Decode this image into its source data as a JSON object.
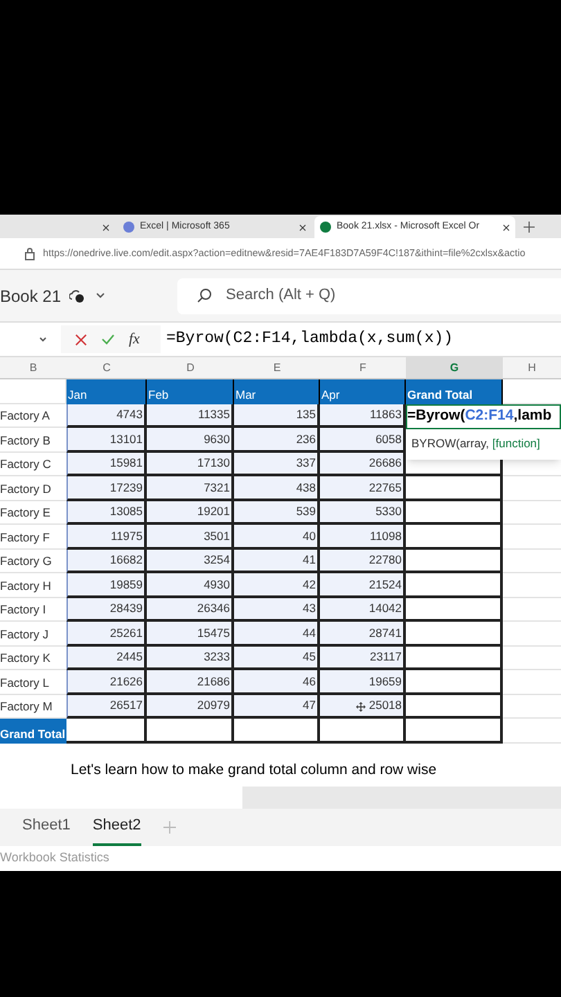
{
  "browser": {
    "tabs": [
      {
        "selected": false
      },
      {
        "title": "Excel | Microsoft 365",
        "selected": false
      },
      {
        "title": "Book 21.xlsx - Microsoft Excel Or",
        "selected": true
      }
    ],
    "url": "https://onedrive.live.com/edit.aspx?action=editnew&resid=7AE4F183D7A59F4C!187&ithint=file%2cxlsx&actio"
  },
  "app": {
    "doc_title": "Book 21",
    "search": {
      "placeholder": "Search (Alt + Q)"
    }
  },
  "formula_bar": {
    "function_label": "fx",
    "formula": "=Byrow(C2:F14,lambda(x,sum(x))"
  },
  "column_headers": [
    {
      "label": "B",
      "selected": false
    },
    {
      "label": "C",
      "selected": false
    },
    {
      "label": "D",
      "selected": false
    },
    {
      "label": "E",
      "selected": false
    },
    {
      "label": "F",
      "selected": false
    },
    {
      "label": "G",
      "selected": true
    },
    {
      "label": "H",
      "selected": false
    }
  ],
  "table": {
    "header": [
      "Jan",
      "Feb",
      "Mar",
      "Apr",
      "Grand Total"
    ],
    "rows": [
      {
        "label": "Factory A",
        "values": [
          "4743",
          "11335",
          "135",
          "11863"
        ]
      },
      {
        "label": "Factory B",
        "values": [
          "13101",
          "9630",
          "236",
          "6058"
        ]
      },
      {
        "label": "Factory C",
        "values": [
          "15981",
          "17130",
          "337",
          "26686"
        ]
      },
      {
        "label": "Factory D",
        "values": [
          "17239",
          "7321",
          "438",
          "22765"
        ]
      },
      {
        "label": "Factory E",
        "values": [
          "13085",
          "19201",
          "539",
          "5330"
        ]
      },
      {
        "label": "Factory F",
        "values": [
          "11975",
          "3501",
          "40",
          "11098"
        ]
      },
      {
        "label": "Factory G",
        "values": [
          "16682",
          "3254",
          "41",
          "22780"
        ]
      },
      {
        "label": "Factory H",
        "values": [
          "19859",
          "4930",
          "42",
          "21524"
        ]
      },
      {
        "label": "Factory I",
        "values": [
          "28439",
          "26346",
          "43",
          "14042"
        ]
      },
      {
        "label": "Factory J",
        "values": [
          "25261",
          "15475",
          "44",
          "28741"
        ]
      },
      {
        "label": "Factory K",
        "values": [
          "2445",
          "3233",
          "45",
          "23117"
        ]
      },
      {
        "label": "Factory L",
        "values": [
          "21626",
          "21686",
          "46",
          "19659"
        ]
      },
      {
        "label": "Factory M",
        "values": [
          "26517",
          "20979",
          "47",
          "25018"
        ]
      }
    ],
    "total_label": "Grand Total"
  },
  "cell_editor": {
    "prefix": "=Byrow(",
    "reference": "C2:F14",
    "suffix": ",lamb"
  },
  "tooltip": {
    "signature": "BYROW(array, ",
    "argument": "[function]"
  },
  "caption": "Let's learn how to make grand total column and row wise",
  "sheet_tabs": [
    {
      "label": "Sheet1",
      "selected": false
    },
    {
      "label": "Sheet2",
      "selected": true
    }
  ],
  "status_bar": "Workbook Statistics"
}
